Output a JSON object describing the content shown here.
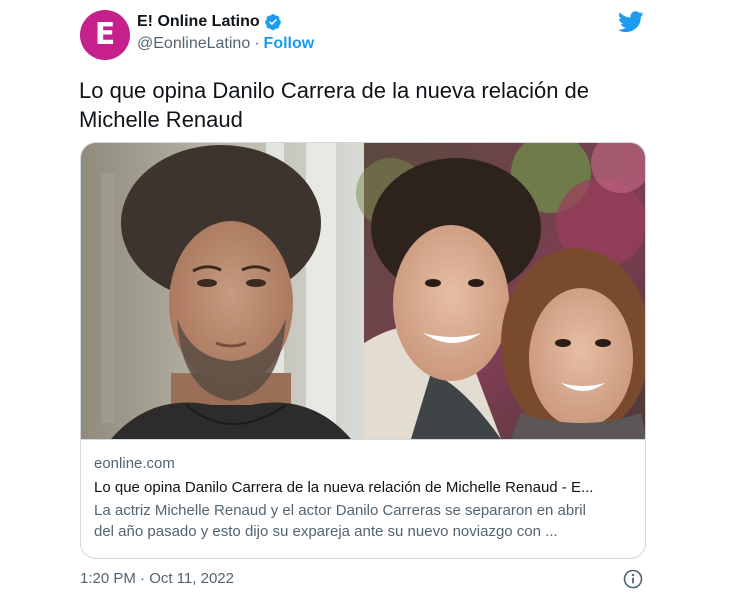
{
  "author": {
    "avatar_letter": "E",
    "name": "E! Online Latino",
    "handle": "@EonlineLatino",
    "separator": "·",
    "follow_label": "Follow"
  },
  "colors": {
    "avatar": "#c6208c",
    "twitter_blue": "#1d9bf0",
    "text_secondary": "#536471"
  },
  "icons": {
    "verified": "verified-badge-icon",
    "brand": "twitter-bird-icon",
    "info": "info-icon"
  },
  "tweet": {
    "text_line1": "Lo que opina Danilo Carrera de la nueva relación de",
    "text_line2": "Michelle Renaud"
  },
  "card": {
    "domain": "eonline.com",
    "title": "Lo que opina Danilo Carrera de la nueva relación de Michelle Renaud - E...",
    "description_line1": "La actriz Michelle Renaud y el actor Danilo Carreras se separaron en abril",
    "description_line2": "del año pasado y esto dijo su expareja ante su nuevo noviazgo con ..."
  },
  "timestamp": "1:20 PM · Oct 11, 2022"
}
